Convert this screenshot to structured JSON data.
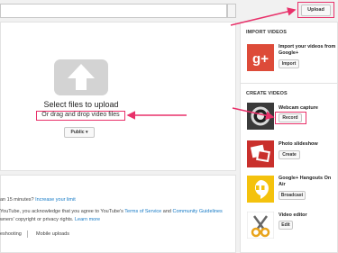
{
  "toolbar": {
    "upload_label": "Upload"
  },
  "main": {
    "select_title": "Select files to upload",
    "drag_text": "Or drag and drop video files",
    "privacy_label": "Public",
    "privacy_caret": "▾"
  },
  "bottom": {
    "line1_prefix": "an 15 minutes?",
    "line1_link": "Increase your limit",
    "line2_a": "YouTube, you acknowledge that you agree to YouTube's",
    "line2_link1": "Terms of Service",
    "line2_and": "and",
    "line2_link2": "Community Guidelines",
    "line3_a": "wners' copyright or privacy rights.",
    "line3_link": "Learn more",
    "footer_left": "eshooting",
    "footer_right": "Mobile uploads"
  },
  "sidebar": {
    "import_heading": "IMPORT VIDEOS",
    "import_item": {
      "title": "Import your videos from Google+",
      "button": "Import"
    },
    "create_heading": "CREATE VIDEOS",
    "create_items": [
      {
        "title": "Webcam capture",
        "button": "Record",
        "icon": "webcam-icon"
      },
      {
        "title": "Photo slideshow",
        "button": "Create",
        "icon": "photos-icon"
      },
      {
        "title": "Google+ Hangouts On Air",
        "button": "Broadcast",
        "icon": "hangouts-icon"
      },
      {
        "title": "Video editor",
        "button": "Edit",
        "icon": "scissors-icon"
      }
    ]
  },
  "colors": {
    "annotation": "#e8316a",
    "google_plus": "#dd4b39",
    "hangouts": "#f4c20d",
    "link": "#167ac6"
  }
}
